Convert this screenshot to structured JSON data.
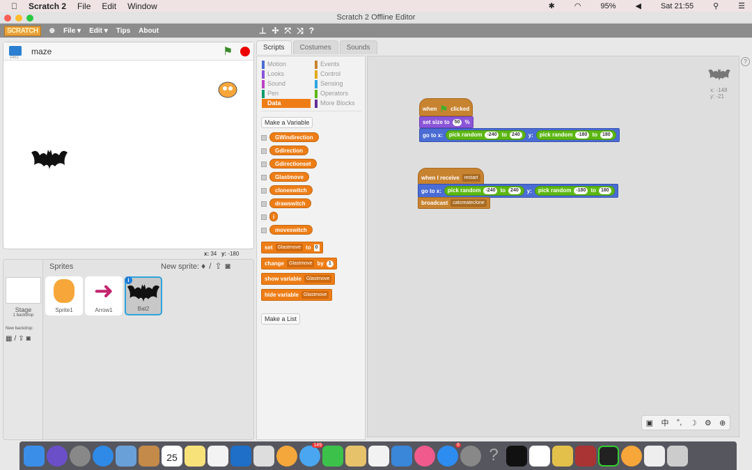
{
  "menubar": {
    "app": "Scratch 2",
    "items": [
      "File",
      "Edit",
      "Window"
    ],
    "battery": "95%",
    "clock": "Sat 21:55"
  },
  "window": {
    "title": "Scratch 2 Offline Editor"
  },
  "toolbar": {
    "logo": "SCRATCH",
    "menus": [
      "File ▾",
      "Edit ▾",
      "Tips",
      "About"
    ]
  },
  "stage": {
    "project_name": "maze",
    "version": "v461",
    "mouse_x": "34",
    "mouse_y": "-180",
    "x_label": "x:",
    "y_label": "y:"
  },
  "sprites": {
    "header": "Sprites",
    "new_sprite": "New sprite:",
    "stage_label": "Stage",
    "stage_sub": "1 backdrop",
    "new_backdrop": "New backdrop:",
    "items": [
      {
        "name": "Sprite1"
      },
      {
        "name": "Arrow1"
      },
      {
        "name": "Bat2",
        "selected": true
      }
    ]
  },
  "tabs": [
    "Scripts",
    "Costumes",
    "Sounds"
  ],
  "categories": [
    {
      "name": "Motion",
      "color": "#4a6cd4"
    },
    {
      "name": "Looks",
      "color": "#8a55d7"
    },
    {
      "name": "Sound",
      "color": "#bb42c3"
    },
    {
      "name": "Pen",
      "color": "#0e9a6c"
    },
    {
      "name": "Data",
      "color": "#ee7d16",
      "active": true
    },
    {
      "name": "Events",
      "color": "#c88330"
    },
    {
      "name": "Control",
      "color": "#e1a91a"
    },
    {
      "name": "Sensing",
      "color": "#2ca5e2"
    },
    {
      "name": "Operators",
      "color": "#5cb712"
    },
    {
      "name": "More Blocks",
      "color": "#632d99"
    }
  ],
  "palette": {
    "make_variable": "Make a Variable",
    "make_list": "Make a List",
    "variables": [
      "GWindirection",
      "Gdirection",
      "Gdirectionset",
      "Glastmove",
      "cloneswitch",
      "drawswitch",
      "i",
      "moveswitch"
    ],
    "set": {
      "kw": "set",
      "var": "Glastmove",
      "to": "to",
      "val": "0"
    },
    "change": {
      "kw": "change",
      "var": "Glastmove",
      "by": "by",
      "val": "1"
    },
    "show": {
      "kw": "show variable",
      "var": "Glastmove"
    },
    "hide": {
      "kw": "hide variable",
      "var": "Glastmove"
    }
  },
  "scripts": {
    "s1": {
      "when": "when",
      "clicked": "clicked",
      "setsize": "set size to",
      "size": "50",
      "pct": "%"
    },
    "goto": {
      "goto": "go to x:",
      "pick": "pick random",
      "x1": "-240",
      "to": "to",
      "x2": "240",
      "y": "y:",
      "y1": "-180",
      "y2": "180"
    },
    "s2": {
      "when": "when I receive",
      "msg": "restart",
      "broadcast": "broadcast",
      "bmsg": "catcreateclone"
    },
    "sprite_x": "x: -148",
    "sprite_y": "y: -21"
  },
  "ime": [
    "中",
    "°,",
    "☽",
    "⚙"
  ],
  "dock": {
    "calendar_day": "25",
    "messages_badge": "149",
    "appstore_badge": "6"
  }
}
